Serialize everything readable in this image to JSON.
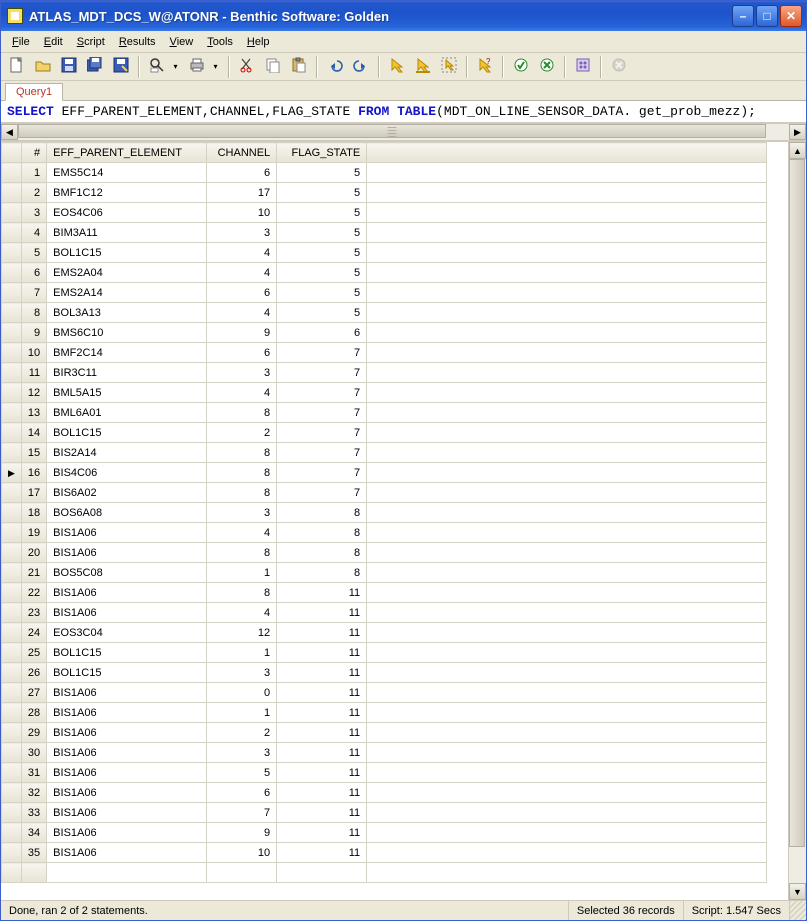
{
  "window": {
    "title": "ATLAS_MDT_DCS_W@ATONR - Benthic Software: Golden"
  },
  "menu": [
    "File",
    "Edit",
    "Script",
    "Results",
    "View",
    "Tools",
    "Help"
  ],
  "tabs": [
    {
      "label": "Query1"
    }
  ],
  "sql": {
    "kw1": "SELECT",
    "cols": " EFF_PARENT_ELEMENT,CHANNEL,FLAG_STATE ",
    "kw2": "FROM",
    "kw3": " TABLE",
    "tail": "(MDT_ON_LINE_SENSOR_DATA. get_prob_mezz);"
  },
  "columns": {
    "rownum": "#",
    "epe": "EFF_PARENT_ELEMENT",
    "ch": "CHANNEL",
    "fs": "FLAG_STATE"
  },
  "current_row_index": 15,
  "rows": [
    {
      "n": 1,
      "epe": "EMS5C14",
      "ch": 6,
      "fs": 5
    },
    {
      "n": 2,
      "epe": "BMF1C12",
      "ch": 17,
      "fs": 5
    },
    {
      "n": 3,
      "epe": "EOS4C06",
      "ch": 10,
      "fs": 5
    },
    {
      "n": 4,
      "epe": "BIM3A11",
      "ch": 3,
      "fs": 5
    },
    {
      "n": 5,
      "epe": "BOL1C15",
      "ch": 4,
      "fs": 5
    },
    {
      "n": 6,
      "epe": "EMS2A04",
      "ch": 4,
      "fs": 5
    },
    {
      "n": 7,
      "epe": "EMS2A14",
      "ch": 6,
      "fs": 5
    },
    {
      "n": 8,
      "epe": "BOL3A13",
      "ch": 4,
      "fs": 5
    },
    {
      "n": 9,
      "epe": "BMS6C10",
      "ch": 9,
      "fs": 6
    },
    {
      "n": 10,
      "epe": "BMF2C14",
      "ch": 6,
      "fs": 7
    },
    {
      "n": 11,
      "epe": "BIR3C11",
      "ch": 3,
      "fs": 7
    },
    {
      "n": 12,
      "epe": "BML5A15",
      "ch": 4,
      "fs": 7
    },
    {
      "n": 13,
      "epe": "BML6A01",
      "ch": 8,
      "fs": 7
    },
    {
      "n": 14,
      "epe": "BOL1C15",
      "ch": 2,
      "fs": 7
    },
    {
      "n": 15,
      "epe": "BIS2A14",
      "ch": 8,
      "fs": 7
    },
    {
      "n": 16,
      "epe": "BIS4C06",
      "ch": 8,
      "fs": 7
    },
    {
      "n": 17,
      "epe": "BIS6A02",
      "ch": 8,
      "fs": 7
    },
    {
      "n": 18,
      "epe": "BOS6A08",
      "ch": 3,
      "fs": 8
    },
    {
      "n": 19,
      "epe": "BIS1A06",
      "ch": 4,
      "fs": 8
    },
    {
      "n": 20,
      "epe": "BIS1A06",
      "ch": 8,
      "fs": 8
    },
    {
      "n": 21,
      "epe": "BOS5C08",
      "ch": 1,
      "fs": 8
    },
    {
      "n": 22,
      "epe": "BIS1A06",
      "ch": 8,
      "fs": 11
    },
    {
      "n": 23,
      "epe": "BIS1A06",
      "ch": 4,
      "fs": 11
    },
    {
      "n": 24,
      "epe": "EOS3C04",
      "ch": 12,
      "fs": 11
    },
    {
      "n": 25,
      "epe": "BOL1C15",
      "ch": 1,
      "fs": 11
    },
    {
      "n": 26,
      "epe": "BOL1C15",
      "ch": 3,
      "fs": 11
    },
    {
      "n": 27,
      "epe": "BIS1A06",
      "ch": 0,
      "fs": 11
    },
    {
      "n": 28,
      "epe": "BIS1A06",
      "ch": 1,
      "fs": 11
    },
    {
      "n": 29,
      "epe": "BIS1A06",
      "ch": 2,
      "fs": 11
    },
    {
      "n": 30,
      "epe": "BIS1A06",
      "ch": 3,
      "fs": 11
    },
    {
      "n": 31,
      "epe": "BIS1A06",
      "ch": 5,
      "fs": 11
    },
    {
      "n": 32,
      "epe": "BIS1A06",
      "ch": 6,
      "fs": 11
    },
    {
      "n": 33,
      "epe": "BIS1A06",
      "ch": 7,
      "fs": 11
    },
    {
      "n": 34,
      "epe": "BIS1A06",
      "ch": 9,
      "fs": 11
    },
    {
      "n": 35,
      "epe": "BIS1A06",
      "ch": 10,
      "fs": 11
    }
  ],
  "status": {
    "left": "Done, ran 2 of 2 statements.",
    "mid": "Selected 36 records",
    "right": "Script: 1.547 Secs"
  },
  "toolbar_names": [
    "new-file-icon",
    "open-file-icon",
    "save-icon",
    "save-all-icon",
    "save-as-icon",
    "sep",
    "find-icon",
    "dropdown",
    "print-icon",
    "dropdown",
    "sep",
    "cut-icon",
    "copy-icon",
    "paste-icon",
    "sep",
    "undo-icon",
    "redo-icon",
    "sep",
    "run-script-icon",
    "run-line-icon",
    "run-selection-icon",
    "sep",
    "explain-plan-icon",
    "sep",
    "commit-icon",
    "rollback-icon",
    "sep",
    "script-options-icon",
    "sep",
    "stop-icon"
  ]
}
